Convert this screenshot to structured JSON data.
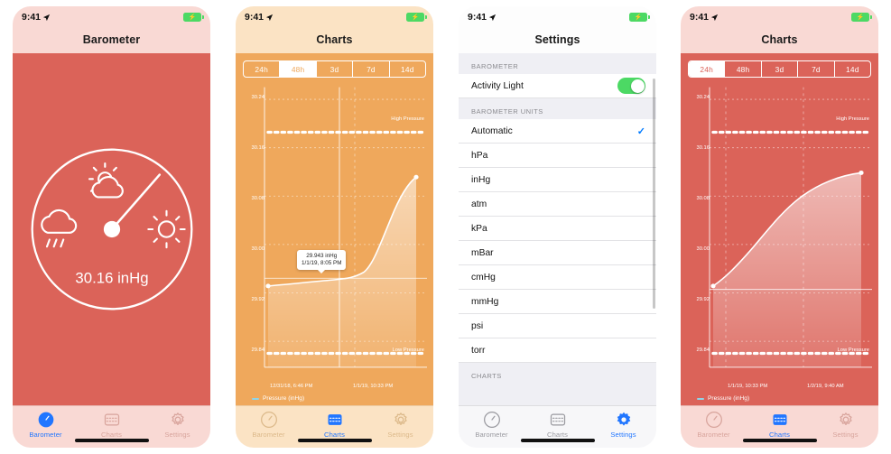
{
  "status_bar": {
    "time": "9:41",
    "location_icon": "location-arrow-icon",
    "battery_icon": "battery-charging-icon"
  },
  "tabs": {
    "barometer": "Barometer",
    "charts": "Charts",
    "settings": "Settings"
  },
  "panel1": {
    "title": "Barometer",
    "gauge": {
      "reading": "30.16 inHg",
      "icon_left": "rain-cloud-icon",
      "icon_top": "sun-behind-cloud-icon",
      "icon_right": "sun-icon"
    },
    "active_tab": "Barometer"
  },
  "panel2": {
    "title": "Charts",
    "segments": [
      "24h",
      "48h",
      "3d",
      "7d",
      "14d"
    ],
    "selected_segment": "48h",
    "active_tab": "Charts",
    "tooltip": {
      "value": "29.943 inHg",
      "timestamp": "1/1/19, 8:05 PM"
    },
    "legend": "Pressure (inHg)"
  },
  "panel3": {
    "title": "Settings",
    "sections": [
      {
        "header": "BAROMETER",
        "rows": [
          {
            "label": "Activity Light",
            "control": "toggle",
            "value": "on"
          }
        ]
      },
      {
        "header": "BAROMETER UNITS",
        "rows": [
          {
            "label": "Automatic",
            "control": "check",
            "value": "checked"
          },
          {
            "label": "hPa",
            "control": "none",
            "value": ""
          },
          {
            "label": "inHg",
            "control": "none",
            "value": ""
          },
          {
            "label": "atm",
            "control": "none",
            "value": ""
          },
          {
            "label": "kPa",
            "control": "none",
            "value": ""
          },
          {
            "label": "mBar",
            "control": "none",
            "value": ""
          },
          {
            "label": "cmHg",
            "control": "none",
            "value": ""
          },
          {
            "label": "mmHg",
            "control": "none",
            "value": ""
          },
          {
            "label": "psi",
            "control": "none",
            "value": ""
          },
          {
            "label": "torr",
            "control": "none",
            "value": ""
          }
        ]
      },
      {
        "header": "CHARTS",
        "rows": []
      }
    ],
    "active_tab": "Settings"
  },
  "panel4": {
    "title": "Charts",
    "segments": [
      "24h",
      "48h",
      "3d",
      "7d",
      "14d"
    ],
    "selected_segment": "24h",
    "active_tab": "Charts",
    "legend": "Pressure (inHg)"
  },
  "colors": {
    "red": "#db6359",
    "red_light": "#f9d9d4",
    "orange": "#efa85c",
    "orange_light": "#fbe3c4",
    "accent_blue": "#007aff",
    "toggle_green": "#4cd964",
    "legend_dash": "#8fd4e8"
  },
  "chart_data": [
    {
      "type": "area",
      "title": "Charts",
      "range": "48h",
      "ylabel": "",
      "xlabel": "",
      "yticks": [
        "30.24",
        "30.16",
        "30.08",
        "30.00",
        "29.92",
        "29.84"
      ],
      "ylim": [
        29.8,
        30.28
      ],
      "xticks": [
        "12/31/18, 6:46 PM",
        "1/1/19, 10:33 PM"
      ],
      "grid": true,
      "legend": "Pressure (inHg)",
      "legend_position": "bottom-left",
      "annotations": [
        {
          "label": "High Pressure",
          "value": 30.18,
          "style": "dotted"
        },
        {
          "label": "Low Pressure",
          "value": 29.8,
          "style": "dotted"
        }
      ],
      "marker": {
        "value": 29.943,
        "timestamp": "1/1/19, 8:05 PM"
      },
      "series": [
        {
          "name": "Pressure (inHg)",
          "x": [
            0,
            8,
            16,
            24,
            32,
            40,
            48,
            56,
            62,
            68,
            74,
            80,
            86,
            92,
            100
          ],
          "values": [
            29.928,
            29.93,
            29.932,
            29.935,
            29.938,
            29.94,
            29.943,
            29.946,
            29.955,
            29.985,
            30.04,
            30.095,
            30.13,
            30.15,
            30.158
          ]
        }
      ]
    },
    {
      "type": "area",
      "title": "Charts",
      "range": "24h",
      "ylabel": "",
      "xlabel": "",
      "yticks": [
        "30.24",
        "30.16",
        "30.08",
        "30.00",
        "29.92",
        "29.84"
      ],
      "ylim": [
        29.8,
        30.28
      ],
      "xticks": [
        "1/1/19, 10:33 PM",
        "1/2/19, 9:40 AM"
      ],
      "grid": true,
      "legend": "Pressure (inHg)",
      "legend_position": "bottom-left",
      "annotations": [
        {
          "label": "High Pressure",
          "value": 30.18,
          "style": "dotted"
        },
        {
          "label": "Low Pressure",
          "value": 29.8,
          "style": "dotted"
        }
      ],
      "series": [
        {
          "name": "Pressure (inHg)",
          "x": [
            0,
            8,
            16,
            26,
            36,
            46,
            56,
            66,
            76,
            86,
            94,
            100
          ],
          "values": [
            29.943,
            29.955,
            29.975,
            30.005,
            30.04,
            30.072,
            30.1,
            30.125,
            30.142,
            30.152,
            30.156,
            30.157
          ]
        }
      ]
    }
  ]
}
